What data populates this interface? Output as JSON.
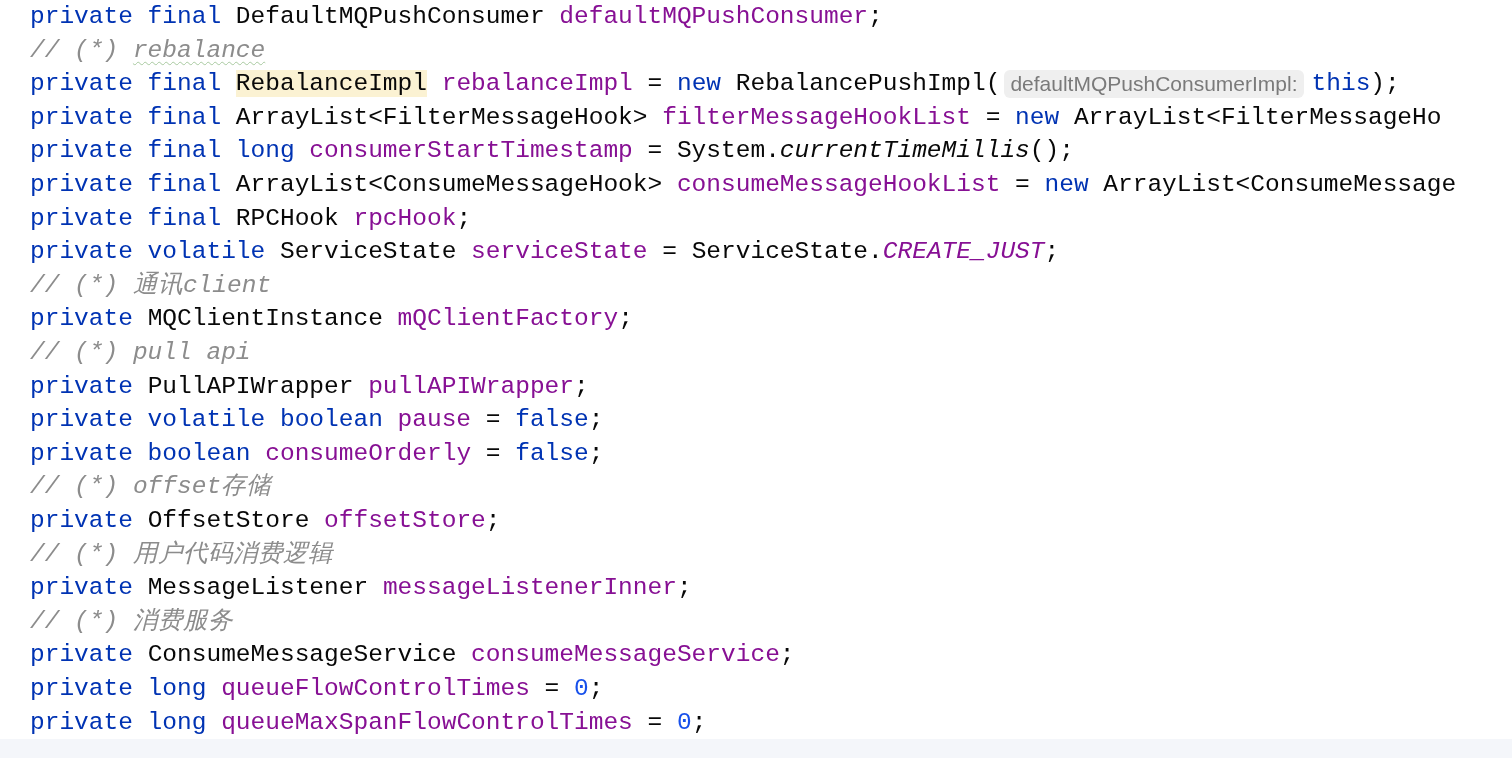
{
  "editor": {
    "lines": [
      {
        "tokens": [
          {
            "kind": "kw",
            "text": "private final "
          },
          {
            "kind": "plain",
            "text": "DefaultMQPushConsumer "
          },
          {
            "kind": "field",
            "text": "defaultMQPushConsumer"
          },
          {
            "kind": "plain",
            "text": ";"
          }
        ]
      },
      {
        "tokens": [
          {
            "kind": "comment",
            "text": "// (*) "
          },
          {
            "kind": "typo",
            "text": "rebalance"
          }
        ]
      },
      {
        "tokens": [
          {
            "kind": "kw",
            "text": "private final "
          },
          {
            "kind": "hl",
            "text": "RebalanceImpl"
          },
          {
            "kind": "field",
            "text": " rebalanceImpl"
          },
          {
            "kind": "plain",
            "text": " = "
          },
          {
            "kind": "kw",
            "text": "new "
          },
          {
            "kind": "plain",
            "text": "RebalancePushImpl("
          },
          {
            "kind": "hint",
            "text": "defaultMQPushConsumerImpl:"
          },
          {
            "kind": "kw",
            "text": "this"
          },
          {
            "kind": "plain",
            "text": ");"
          }
        ]
      },
      {
        "tokens": [
          {
            "kind": "kw",
            "text": "private final "
          },
          {
            "kind": "plain",
            "text": "ArrayList<FilterMessageHook> "
          },
          {
            "kind": "field",
            "text": "filterMessageHookList"
          },
          {
            "kind": "plain",
            "text": " = "
          },
          {
            "kind": "kw",
            "text": "new "
          },
          {
            "kind": "plain",
            "text": "ArrayList<FilterMessageHo"
          }
        ]
      },
      {
        "tokens": [
          {
            "kind": "kw",
            "text": "private final long "
          },
          {
            "kind": "field",
            "text": "consumerStartTimestamp"
          },
          {
            "kind": "plain",
            "text": " = System."
          },
          {
            "kind": "static",
            "text": "currentTimeMillis"
          },
          {
            "kind": "plain",
            "text": "();"
          }
        ]
      },
      {
        "tokens": [
          {
            "kind": "kw",
            "text": "private final "
          },
          {
            "kind": "plain",
            "text": "ArrayList<ConsumeMessageHook> "
          },
          {
            "kind": "field",
            "text": "consumeMessageHookList"
          },
          {
            "kind": "plain",
            "text": " = "
          },
          {
            "kind": "kw",
            "text": "new "
          },
          {
            "kind": "plain",
            "text": "ArrayList<ConsumeMessage"
          }
        ]
      },
      {
        "tokens": [
          {
            "kind": "kw",
            "text": "private final "
          },
          {
            "kind": "plain",
            "text": "RPCHook "
          },
          {
            "kind": "field",
            "text": "rpcHook"
          },
          {
            "kind": "plain",
            "text": ";"
          }
        ]
      },
      {
        "tokens": [
          {
            "kind": "kw",
            "text": "private volatile "
          },
          {
            "kind": "plain",
            "text": "ServiceState "
          },
          {
            "kind": "field",
            "text": "serviceState"
          },
          {
            "kind": "plain",
            "text": " = ServiceState."
          },
          {
            "kind": "const",
            "text": "CREATE_JUST"
          },
          {
            "kind": "plain",
            "text": ";"
          }
        ]
      },
      {
        "tokens": [
          {
            "kind": "comment",
            "text": "// (*) 通讯client"
          }
        ]
      },
      {
        "tokens": [
          {
            "kind": "kw",
            "text": "private "
          },
          {
            "kind": "plain",
            "text": "MQClientInstance "
          },
          {
            "kind": "field",
            "text": "mQClientFactory"
          },
          {
            "kind": "plain",
            "text": ";"
          }
        ]
      },
      {
        "tokens": [
          {
            "kind": "comment",
            "text": "// (*) pull api"
          }
        ]
      },
      {
        "tokens": [
          {
            "kind": "kw",
            "text": "private "
          },
          {
            "kind": "plain",
            "text": "PullAPIWrapper "
          },
          {
            "kind": "field",
            "text": "pullAPIWrapper"
          },
          {
            "kind": "plain",
            "text": ";"
          }
        ]
      },
      {
        "tokens": [
          {
            "kind": "kw",
            "text": "private volatile boolean "
          },
          {
            "kind": "field",
            "text": "pause"
          },
          {
            "kind": "plain",
            "text": " = "
          },
          {
            "kind": "kw",
            "text": "false"
          },
          {
            "kind": "plain",
            "text": ";"
          }
        ]
      },
      {
        "tokens": [
          {
            "kind": "kw",
            "text": "private boolean "
          },
          {
            "kind": "field",
            "text": "consumeOrderly"
          },
          {
            "kind": "plain",
            "text": " = "
          },
          {
            "kind": "kw",
            "text": "false"
          },
          {
            "kind": "plain",
            "text": ";"
          }
        ]
      },
      {
        "tokens": [
          {
            "kind": "comment",
            "text": "// (*) offset存储"
          }
        ]
      },
      {
        "tokens": [
          {
            "kind": "kw",
            "text": "private "
          },
          {
            "kind": "plain",
            "text": "OffsetStore "
          },
          {
            "kind": "field",
            "text": "offsetStore"
          },
          {
            "kind": "plain",
            "text": ";"
          }
        ]
      },
      {
        "tokens": [
          {
            "kind": "comment",
            "text": "// (*) 用户代码消费逻辑"
          }
        ]
      },
      {
        "tokens": [
          {
            "kind": "kw",
            "text": "private "
          },
          {
            "kind": "plain",
            "text": "MessageListener "
          },
          {
            "kind": "field",
            "text": "messageListenerInner"
          },
          {
            "kind": "plain",
            "text": ";"
          }
        ]
      },
      {
        "tokens": [
          {
            "kind": "comment",
            "text": "// (*) 消费服务"
          }
        ]
      },
      {
        "tokens": [
          {
            "kind": "kw",
            "text": "private "
          },
          {
            "kind": "plain",
            "text": "ConsumeMessageService "
          },
          {
            "kind": "field",
            "text": "consumeMessageService"
          },
          {
            "kind": "plain",
            "text": ";"
          }
        ]
      },
      {
        "tokens": [
          {
            "kind": "kw",
            "text": "private long "
          },
          {
            "kind": "field",
            "text": "queueFlowControlTimes"
          },
          {
            "kind": "plain",
            "text": " = "
          },
          {
            "kind": "num",
            "text": "0"
          },
          {
            "kind": "plain",
            "text": ";"
          }
        ]
      },
      {
        "tokens": [
          {
            "kind": "kw",
            "text": "private long "
          },
          {
            "kind": "field",
            "text": "queueMaxSpanFlowControlTimes"
          },
          {
            "kind": "plain",
            "text": " = "
          },
          {
            "kind": "num",
            "text": "0"
          },
          {
            "kind": "plain",
            "text": ";"
          }
        ]
      }
    ]
  }
}
